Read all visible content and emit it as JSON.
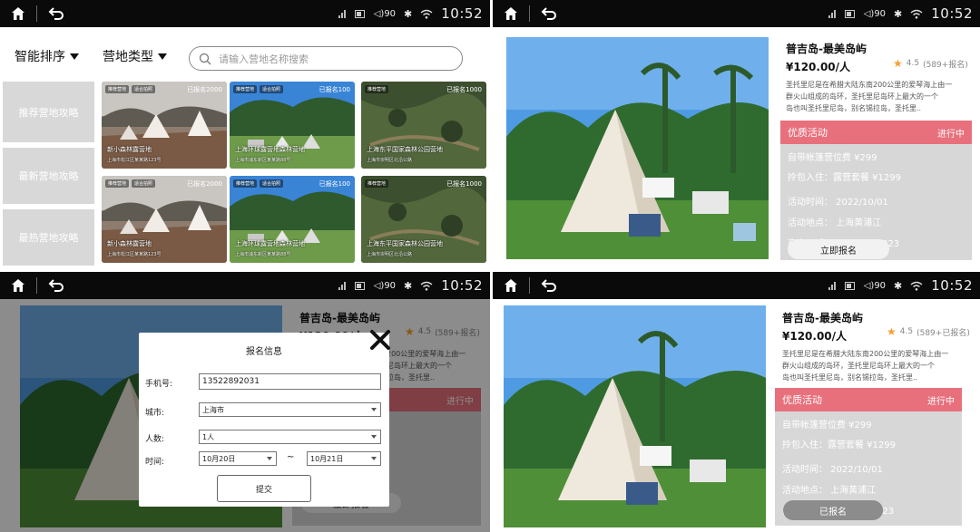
{
  "statusbar": {
    "time": "10:52",
    "volume": "90"
  },
  "list_screen": {
    "sort_label": "智能排序",
    "type_label": "营地类型",
    "search_placeholder": "请输入营地名称搜索",
    "categories": [
      "推荐营地攻略",
      "最新营地攻略",
      "最热营地攻略"
    ],
    "cards": [
      {
        "tags": [
          "推荐营地",
          "适合拍照"
        ],
        "status": "已报名2000",
        "title": "新小森林露营地",
        "address": "上海市松江区某某路123号"
      },
      {
        "tags": [
          "推荐营地",
          "适合拍照"
        ],
        "status": "已报名100",
        "title": "上海环球露营地森林营地",
        "address": "上海市浦东新区某某路88号"
      },
      {
        "tags": [
          "推荐营地"
        ],
        "status": "已报名1000",
        "title": "上海东平国家森林公园营地",
        "address": "上海市崇明区北沿公路"
      },
      {
        "tags": [
          "推荐营地",
          "适合拍照"
        ],
        "status": "已报名2000",
        "title": "新小森林露营地",
        "address": "上海市松江区某某路123号"
      },
      {
        "tags": [
          "推荐营地",
          "适合拍照"
        ],
        "status": "已报名100",
        "title": "上海环球露营地森林营地",
        "address": "上海市浦东新区某某路88号"
      },
      {
        "tags": [
          "推荐营地"
        ],
        "status": "已报名1000",
        "title": "上海东平国家森林公园营地",
        "address": "上海市崇明区北沿公路"
      }
    ]
  },
  "detail": {
    "title": "普吉岛-最美岛屿",
    "price": "¥120.00/人",
    "rating": "4.5",
    "rating_count": "(589+报名)",
    "rating_count_joined": "(589+已报名)",
    "desc_lines": [
      "圣托里尼是在希腊大陆东南200公里的爱琴海上由一",
      "群火山组成的岛环，圣托里尼岛环上最大的一个",
      "岛也叫圣托里尼岛，别名锡拉岛，圣托里.."
    ],
    "promo_title": "优质活动",
    "promo_status": "进行中",
    "promo_item1": "自带帐篷营位费  ¥299",
    "promo_item2": "拎包入住：露营套餐  ¥1299",
    "promo_time": "活动时间：  2022/10/01",
    "promo_place": "活动地点：  上海黄浦江",
    "promo_phone": "商家电话：  13477839923",
    "signup_button": "立即报名",
    "signed_button": "已报名"
  },
  "form": {
    "title": "报名信息",
    "phone_label": "手机号:",
    "phone_value": "13522892031",
    "city_label": "城市:",
    "city_value": "上海市",
    "people_label": "人数:",
    "people_value": "1人",
    "time_label": "时间:",
    "start_value": "10月20日",
    "tilde": "~",
    "end_value": "10月21日",
    "submit": "提交"
  },
  "colors": {
    "promo_head": "#e8707c",
    "promo_body": "#d7d7d7",
    "star": "#f2a230",
    "statusbar": "#0a0a0a"
  }
}
